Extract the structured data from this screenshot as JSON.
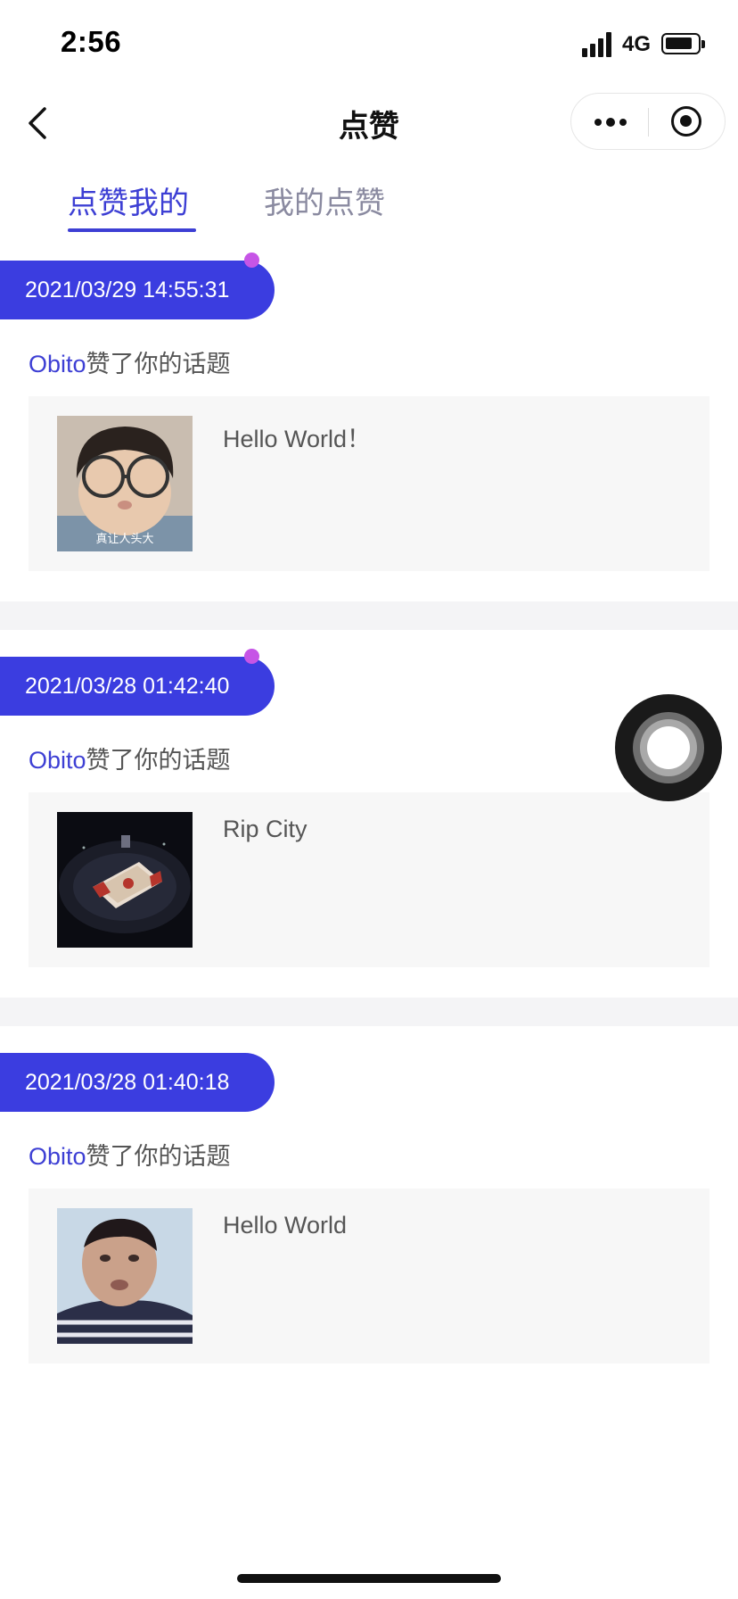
{
  "status_bar": {
    "time": "2:56",
    "network": "4G"
  },
  "nav": {
    "title": "点赞"
  },
  "tabs": [
    {
      "label": "点赞我的",
      "active": true
    },
    {
      "label": "我的点赞",
      "active": false
    }
  ],
  "entries": [
    {
      "date": "2021/03/29 14:55:31",
      "user": "Obito",
      "action": "赞了你的话题",
      "post_text": "Hello World！",
      "thumb_icon": "kid-with-glasses-photo",
      "thumb_caption": "真让人头大",
      "unread": true
    },
    {
      "date": "2021/03/28 01:42:40",
      "user": "Obito",
      "action": "赞了你的话题",
      "post_text": "Rip City",
      "thumb_icon": "basketball-arena-photo",
      "unread": true
    },
    {
      "date": "2021/03/28 01:40:18",
      "user": "Obito",
      "action": "赞了你的话题",
      "post_text": "Hello World",
      "thumb_icon": "person-selfie-photo",
      "unread": false
    }
  ],
  "colors": {
    "accent": "#3b3de0",
    "unread_dot": "#c655e6",
    "card_bg": "#f7f7f7"
  }
}
